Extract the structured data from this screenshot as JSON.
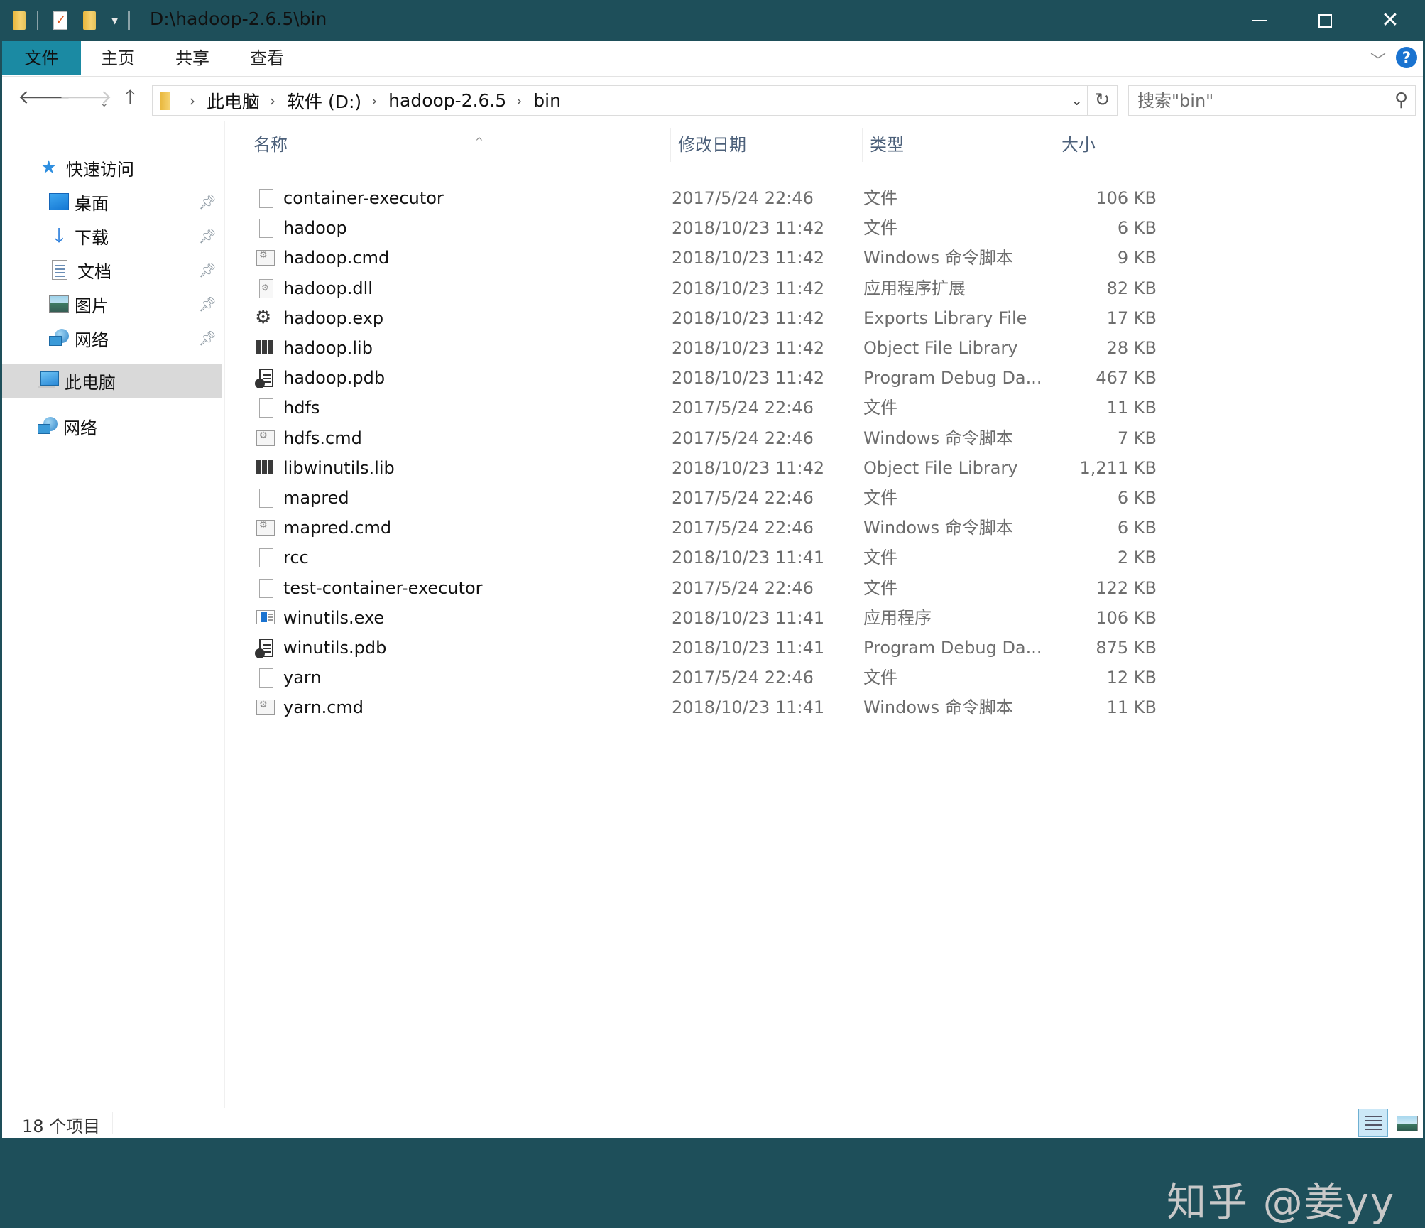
{
  "window": {
    "title": "D:\\hadoop-2.6.5\\bin",
    "controls": {
      "minimize": "minimize",
      "maximize": "maximize",
      "close": "close"
    }
  },
  "quick_access_toolbar": [
    "folder-icon",
    "properties-icon",
    "new-folder-icon",
    "customize-dropdown"
  ],
  "ribbon": {
    "tabs": [
      {
        "label": "文件",
        "active": true
      },
      {
        "label": "主页",
        "active": false
      },
      {
        "label": "共享",
        "active": false
      },
      {
        "label": "查看",
        "active": false
      }
    ],
    "expand_icon": "chevron-down-icon",
    "help_label": "?"
  },
  "address": {
    "breadcrumbs": [
      "此电脑",
      "软件 (D:)",
      "hadoop-2.6.5",
      "bin"
    ],
    "search_placeholder": "搜索\"bin\""
  },
  "sidebar": {
    "quick_access": {
      "label": "快速访问",
      "items": [
        {
          "label": "桌面",
          "icon": "desktop-icon",
          "pinned": true
        },
        {
          "label": "下载",
          "icon": "download-icon",
          "pinned": true
        },
        {
          "label": "文档",
          "icon": "documents-icon",
          "pinned": true
        },
        {
          "label": "图片",
          "icon": "pictures-icon",
          "pinned": true
        },
        {
          "label": "网络",
          "icon": "network-icon",
          "pinned": true
        }
      ]
    },
    "this_pc": {
      "label": "此电脑",
      "selected": true
    },
    "network": {
      "label": "网络"
    }
  },
  "file_list": {
    "columns": {
      "name": "名称",
      "date": "修改日期",
      "type": "类型",
      "size": "大小"
    },
    "sorted_by": "name",
    "files": [
      {
        "name": "container-executor",
        "date": "2017/5/24 22:46",
        "type": "文件",
        "size": "106 KB",
        "icon": "blank"
      },
      {
        "name": "hadoop",
        "date": "2018/10/23 11:42",
        "type": "文件",
        "size": "6 KB",
        "icon": "blank"
      },
      {
        "name": "hadoop.cmd",
        "date": "2018/10/23 11:42",
        "type": "Windows 命令脚本",
        "size": "9 KB",
        "icon": "cmd"
      },
      {
        "name": "hadoop.dll",
        "date": "2018/10/23 11:42",
        "type": "应用程序扩展",
        "size": "82 KB",
        "icon": "dll"
      },
      {
        "name": "hadoop.exp",
        "date": "2018/10/23 11:42",
        "type": "Exports Library File",
        "size": "17 KB",
        "icon": "exp"
      },
      {
        "name": "hadoop.lib",
        "date": "2018/10/23 11:42",
        "type": "Object File Library",
        "size": "28 KB",
        "icon": "lib"
      },
      {
        "name": "hadoop.pdb",
        "date": "2018/10/23 11:42",
        "type": "Program Debug Da...",
        "size": "467 KB",
        "icon": "pdb"
      },
      {
        "name": "hdfs",
        "date": "2017/5/24 22:46",
        "type": "文件",
        "size": "11 KB",
        "icon": "blank"
      },
      {
        "name": "hdfs.cmd",
        "date": "2017/5/24 22:46",
        "type": "Windows 命令脚本",
        "size": "7 KB",
        "icon": "cmd"
      },
      {
        "name": "libwinutils.lib",
        "date": "2018/10/23 11:42",
        "type": "Object File Library",
        "size": "1,211 KB",
        "icon": "lib"
      },
      {
        "name": "mapred",
        "date": "2017/5/24 22:46",
        "type": "文件",
        "size": "6 KB",
        "icon": "blank"
      },
      {
        "name": "mapred.cmd",
        "date": "2017/5/24 22:46",
        "type": "Windows 命令脚本",
        "size": "6 KB",
        "icon": "cmd"
      },
      {
        "name": "rcc",
        "date": "2018/10/23 11:41",
        "type": "文件",
        "size": "2 KB",
        "icon": "blank"
      },
      {
        "name": "test-container-executor",
        "date": "2017/5/24 22:46",
        "type": "文件",
        "size": "122 KB",
        "icon": "blank"
      },
      {
        "name": "winutils.exe",
        "date": "2018/10/23 11:41",
        "type": "应用程序",
        "size": "106 KB",
        "icon": "exe"
      },
      {
        "name": "winutils.pdb",
        "date": "2018/10/23 11:41",
        "type": "Program Debug Da...",
        "size": "875 KB",
        "icon": "pdb"
      },
      {
        "name": "yarn",
        "date": "2017/5/24 22:46",
        "type": "文件",
        "size": "12 KB",
        "icon": "blank"
      },
      {
        "name": "yarn.cmd",
        "date": "2018/10/23 11:41",
        "type": "Windows 命令脚本",
        "size": "11 KB",
        "icon": "cmd"
      }
    ]
  },
  "watermark": "知乎 @姜yy",
  "status_bar": {
    "item_count": "18 个项目",
    "views": [
      "details-view",
      "large-icons-view"
    ]
  }
}
